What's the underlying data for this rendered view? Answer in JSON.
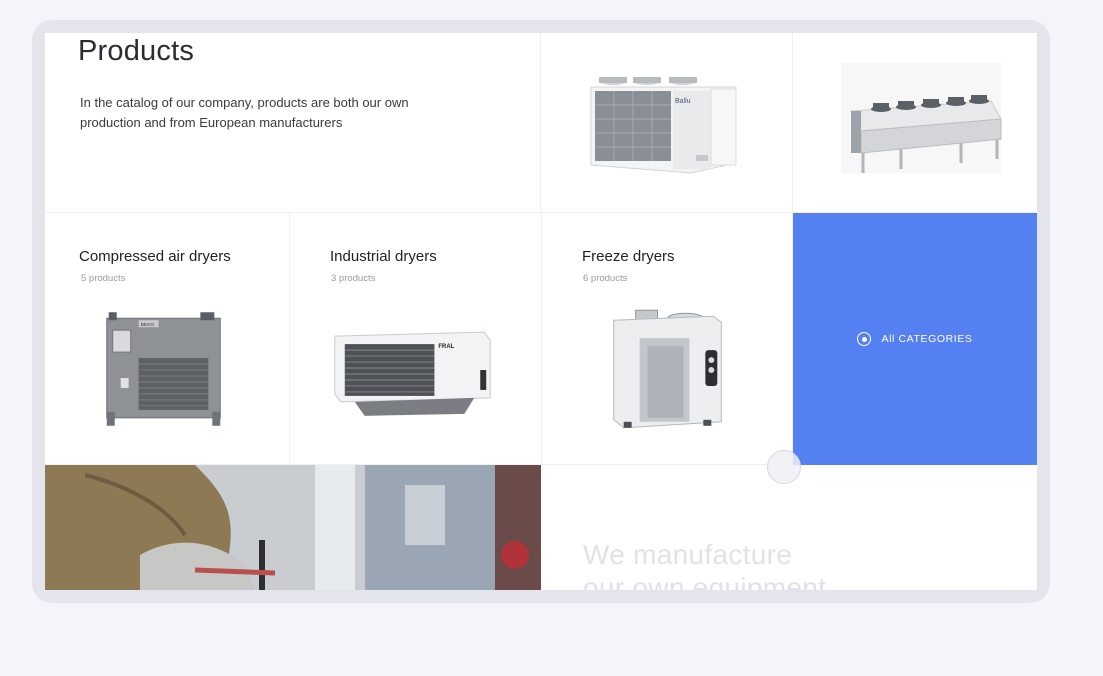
{
  "intro": {
    "title": "Products",
    "description": "In the catalog of our company, products are both our own production and from European manufacturers"
  },
  "featured_images": [
    {
      "name": "chiller-unit",
      "brand_text": "Ballu"
    },
    {
      "name": "dry-cooler-unit"
    }
  ],
  "categories": [
    {
      "title": "Compressed air dryers",
      "count": "5 products",
      "image": "compressed-air-dryer",
      "brand_text": "BEKO"
    },
    {
      "title": "Industrial dryers",
      "count": "3 products",
      "image": "industrial-dryer",
      "brand_text": "FRAL"
    },
    {
      "title": "Freeze dryers",
      "count": "6 products",
      "image": "freeze-dryer"
    }
  ],
  "all_categories": {
    "label": "All CATEGORIES",
    "accent": "#5580f2"
  },
  "tagline": {
    "line1": "We manufacture",
    "line2": "our own equipment"
  }
}
